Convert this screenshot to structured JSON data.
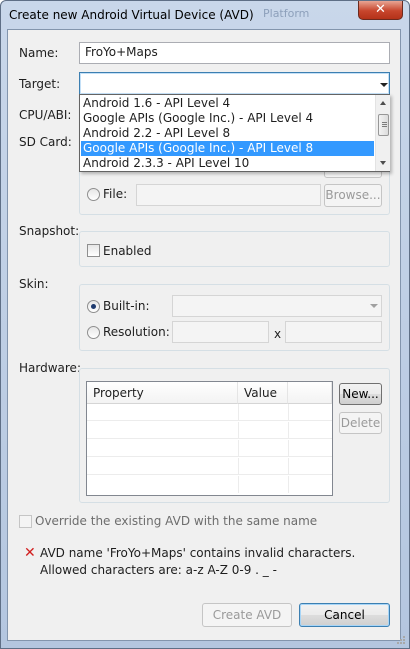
{
  "window": {
    "title": "Create new Android Virtual Device (AVD)",
    "background_title": "Platform",
    "close_glyph": "✕"
  },
  "labels": {
    "name": "Name:",
    "target": "Target:",
    "cpu_abi": "CPU/ABI:",
    "sd_card": "SD Card:",
    "snapshot": "Snapshot:",
    "skin": "Skin:",
    "hardware": "Hardware:"
  },
  "name_field": {
    "value": "FroYo+Maps"
  },
  "target": {
    "value": "",
    "options": [
      "Android 1.6 - API Level 4",
      "Google APIs (Google Inc.) - API Level 4",
      "Android 2.2 - API Level 8",
      "Google APIs (Google Inc.) - API Level 8",
      "Android 2.3.3 - API Level 10"
    ],
    "highlighted_index": 3
  },
  "sd_card": {
    "file_label": "File:",
    "file_value": "",
    "browse_label": "Browse..."
  },
  "snapshot": {
    "enabled_label": "Enabled"
  },
  "skin": {
    "builtin_label": "Built-in:",
    "builtin_selected": true,
    "resolution_label": "Resolution:",
    "x_separator": "x"
  },
  "hardware": {
    "columns": [
      "Property",
      "Value"
    ],
    "rows": [],
    "new_label": "New...",
    "delete_label": "Delete"
  },
  "override": {
    "label": "Override the existing AVD with the same name"
  },
  "error": {
    "icon": "✕",
    "line1": "AVD name 'FroYo+Maps' contains invalid characters.",
    "line2": "Allowed characters are: a-z A-Z 0-9 . _ -"
  },
  "buttons": {
    "create": "Create AVD",
    "cancel": "Cancel"
  },
  "colors": {
    "selection": "#3399ff",
    "error": "#d11e1e",
    "focus_border": "#3c7fb1"
  }
}
